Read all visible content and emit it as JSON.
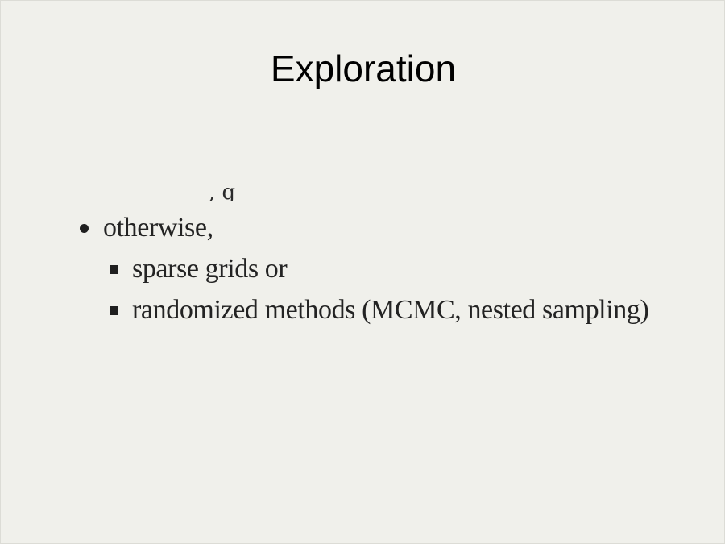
{
  "slide": {
    "title": "Exploration",
    "cut_text_fragment": ", g",
    "bullets": [
      {
        "label": "otherwise,",
        "marker": "round-bullet",
        "sub_bullets": [
          {
            "label": "sparse grids or",
            "marker": "square-bullet"
          },
          {
            "label": "randomized methods (MCMC, nested sampling)",
            "marker": "square-bullet"
          }
        ]
      }
    ]
  },
  "colors": {
    "background": "#f0f0eb",
    "text": "#232323",
    "title": "#000000"
  }
}
